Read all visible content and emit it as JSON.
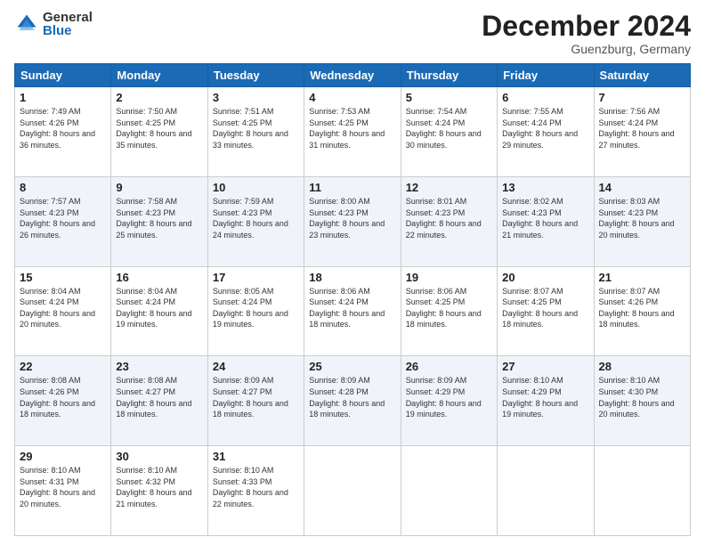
{
  "logo": {
    "general": "General",
    "blue": "Blue"
  },
  "header": {
    "month": "December 2024",
    "location": "Guenzburg, Germany"
  },
  "days_of_week": [
    "Sunday",
    "Monday",
    "Tuesday",
    "Wednesday",
    "Thursday",
    "Friday",
    "Saturday"
  ],
  "weeks": [
    [
      {
        "day": 1,
        "sunrise": "7:49 AM",
        "sunset": "4:26 PM",
        "daylight": "8 hours and 36 minutes."
      },
      {
        "day": 2,
        "sunrise": "7:50 AM",
        "sunset": "4:25 PM",
        "daylight": "8 hours and 35 minutes."
      },
      {
        "day": 3,
        "sunrise": "7:51 AM",
        "sunset": "4:25 PM",
        "daylight": "8 hours and 33 minutes."
      },
      {
        "day": 4,
        "sunrise": "7:53 AM",
        "sunset": "4:25 PM",
        "daylight": "8 hours and 31 minutes."
      },
      {
        "day": 5,
        "sunrise": "7:54 AM",
        "sunset": "4:24 PM",
        "daylight": "8 hours and 30 minutes."
      },
      {
        "day": 6,
        "sunrise": "7:55 AM",
        "sunset": "4:24 PM",
        "daylight": "8 hours and 29 minutes."
      },
      {
        "day": 7,
        "sunrise": "7:56 AM",
        "sunset": "4:24 PM",
        "daylight": "8 hours and 27 minutes."
      }
    ],
    [
      {
        "day": 8,
        "sunrise": "7:57 AM",
        "sunset": "4:23 PM",
        "daylight": "8 hours and 26 minutes."
      },
      {
        "day": 9,
        "sunrise": "7:58 AM",
        "sunset": "4:23 PM",
        "daylight": "8 hours and 25 minutes."
      },
      {
        "day": 10,
        "sunrise": "7:59 AM",
        "sunset": "4:23 PM",
        "daylight": "8 hours and 24 minutes."
      },
      {
        "day": 11,
        "sunrise": "8:00 AM",
        "sunset": "4:23 PM",
        "daylight": "8 hours and 23 minutes."
      },
      {
        "day": 12,
        "sunrise": "8:01 AM",
        "sunset": "4:23 PM",
        "daylight": "8 hours and 22 minutes."
      },
      {
        "day": 13,
        "sunrise": "8:02 AM",
        "sunset": "4:23 PM",
        "daylight": "8 hours and 21 minutes."
      },
      {
        "day": 14,
        "sunrise": "8:03 AM",
        "sunset": "4:23 PM",
        "daylight": "8 hours and 20 minutes."
      }
    ],
    [
      {
        "day": 15,
        "sunrise": "8:04 AM",
        "sunset": "4:24 PM",
        "daylight": "8 hours and 20 minutes."
      },
      {
        "day": 16,
        "sunrise": "8:04 AM",
        "sunset": "4:24 PM",
        "daylight": "8 hours and 19 minutes."
      },
      {
        "day": 17,
        "sunrise": "8:05 AM",
        "sunset": "4:24 PM",
        "daylight": "8 hours and 19 minutes."
      },
      {
        "day": 18,
        "sunrise": "8:06 AM",
        "sunset": "4:24 PM",
        "daylight": "8 hours and 18 minutes."
      },
      {
        "day": 19,
        "sunrise": "8:06 AM",
        "sunset": "4:25 PM",
        "daylight": "8 hours and 18 minutes."
      },
      {
        "day": 20,
        "sunrise": "8:07 AM",
        "sunset": "4:25 PM",
        "daylight": "8 hours and 18 minutes."
      },
      {
        "day": 21,
        "sunrise": "8:07 AM",
        "sunset": "4:26 PM",
        "daylight": "8 hours and 18 minutes."
      }
    ],
    [
      {
        "day": 22,
        "sunrise": "8:08 AM",
        "sunset": "4:26 PM",
        "daylight": "8 hours and 18 minutes."
      },
      {
        "day": 23,
        "sunrise": "8:08 AM",
        "sunset": "4:27 PM",
        "daylight": "8 hours and 18 minutes."
      },
      {
        "day": 24,
        "sunrise": "8:09 AM",
        "sunset": "4:27 PM",
        "daylight": "8 hours and 18 minutes."
      },
      {
        "day": 25,
        "sunrise": "8:09 AM",
        "sunset": "4:28 PM",
        "daylight": "8 hours and 18 minutes."
      },
      {
        "day": 26,
        "sunrise": "8:09 AM",
        "sunset": "4:29 PM",
        "daylight": "8 hours and 19 minutes."
      },
      {
        "day": 27,
        "sunrise": "8:10 AM",
        "sunset": "4:29 PM",
        "daylight": "8 hours and 19 minutes."
      },
      {
        "day": 28,
        "sunrise": "8:10 AM",
        "sunset": "4:30 PM",
        "daylight": "8 hours and 20 minutes."
      }
    ],
    [
      {
        "day": 29,
        "sunrise": "8:10 AM",
        "sunset": "4:31 PM",
        "daylight": "8 hours and 20 minutes."
      },
      {
        "day": 30,
        "sunrise": "8:10 AM",
        "sunset": "4:32 PM",
        "daylight": "8 hours and 21 minutes."
      },
      {
        "day": 31,
        "sunrise": "8:10 AM",
        "sunset": "4:33 PM",
        "daylight": "8 hours and 22 minutes."
      },
      null,
      null,
      null,
      null
    ]
  ],
  "labels": {
    "sunrise": "Sunrise:",
    "sunset": "Sunset:",
    "daylight": "Daylight:"
  }
}
